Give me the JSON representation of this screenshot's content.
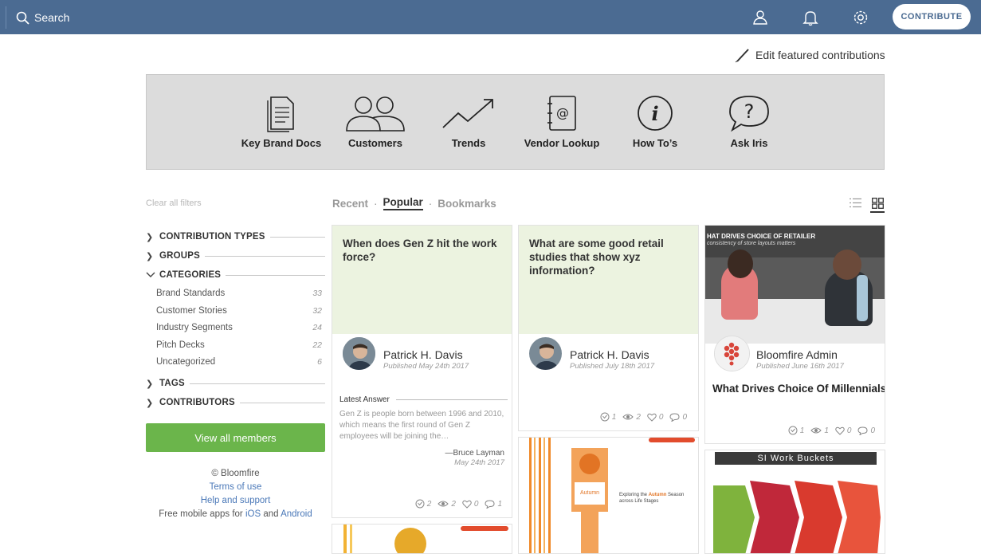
{
  "topbar": {
    "search_label": "Search",
    "contribute_label": "CONTRIBUTE"
  },
  "edit_featured_label": "Edit featured contributions",
  "featured": [
    {
      "label": "Key Brand Docs",
      "icon": "document-icon"
    },
    {
      "label": "Customers",
      "icon": "people-icon"
    },
    {
      "label": "Trends",
      "icon": "trend-line-icon"
    },
    {
      "label": "Vendor Lookup",
      "icon": "address-book-icon"
    },
    {
      "label": "How To’s",
      "icon": "info-icon"
    },
    {
      "label": "Ask Iris",
      "icon": "question-bubble-icon"
    }
  ],
  "sidebar": {
    "clear_filters": "Clear all filters",
    "filters": {
      "contribution_types": "CONTRIBUTION TYPES",
      "groups": "GROUPS",
      "categories": "CATEGORIES",
      "tags": "TAGS",
      "contributors": "CONTRIBUTORS"
    },
    "categories": [
      {
        "label": "Brand Standards",
        "count": "33"
      },
      {
        "label": "Customer Stories",
        "count": "32"
      },
      {
        "label": "Industry Segments",
        "count": "24"
      },
      {
        "label": "Pitch Decks",
        "count": "22"
      },
      {
        "label": "Uncategorized",
        "count": "6"
      }
    ],
    "view_members": "View all members",
    "footer": {
      "copyright": "© Bloomfire",
      "terms": "Terms of use",
      "help": "Help and support",
      "mobile_prefix": "Free mobile apps for",
      "ios": "iOS",
      "and": "and",
      "android": "Android"
    }
  },
  "tabs": {
    "recent": "Recent",
    "popular": "Popular",
    "bookmarks": "Bookmarks",
    "dot": "·"
  },
  "cards": {
    "c1": {
      "question": "When does Gen Z hit the work force?",
      "author": "Patrick H. Davis",
      "published": "Published May 24th 2017",
      "latest_answer_label": "Latest Answer",
      "latest_answer_text": "Gen Z is people born between 1996 and 2010, which means the first round of Gen Z employees will be joining the…",
      "answer_by": "—Bruce Layman",
      "answer_date": "May 24th 2017",
      "stats": {
        "answers": "2",
        "views": "2",
        "likes": "0",
        "comments": "1"
      }
    },
    "c2": {
      "question": "What are some good retail studies that show xyz information?",
      "author": "Patrick H. Davis",
      "published": "Published July 18th 2017",
      "stats": {
        "answers": "1",
        "views": "2",
        "likes": "0",
        "comments": "0"
      }
    },
    "c3": {
      "image_caption_1": "HAT DRIVES CHOICE OF RETAILER",
      "image_caption_2": "consistency of store layouts matters",
      "author": "Bloomfire Admin",
      "published": "Published June 16th 2017",
      "title": "What Drives Choice Of Millennials",
      "stats": {
        "answers": "1",
        "views": "1",
        "likes": "0",
        "comments": "0"
      }
    },
    "c5": {
      "slide_text_prefix": "Exploring the",
      "slide_text_bold": "Autumn",
      "slide_text_suffix": "Season across Life Stages",
      "badge_text": "Autumn"
    },
    "c6": {
      "slide_title": "SI Work Buckets"
    }
  }
}
